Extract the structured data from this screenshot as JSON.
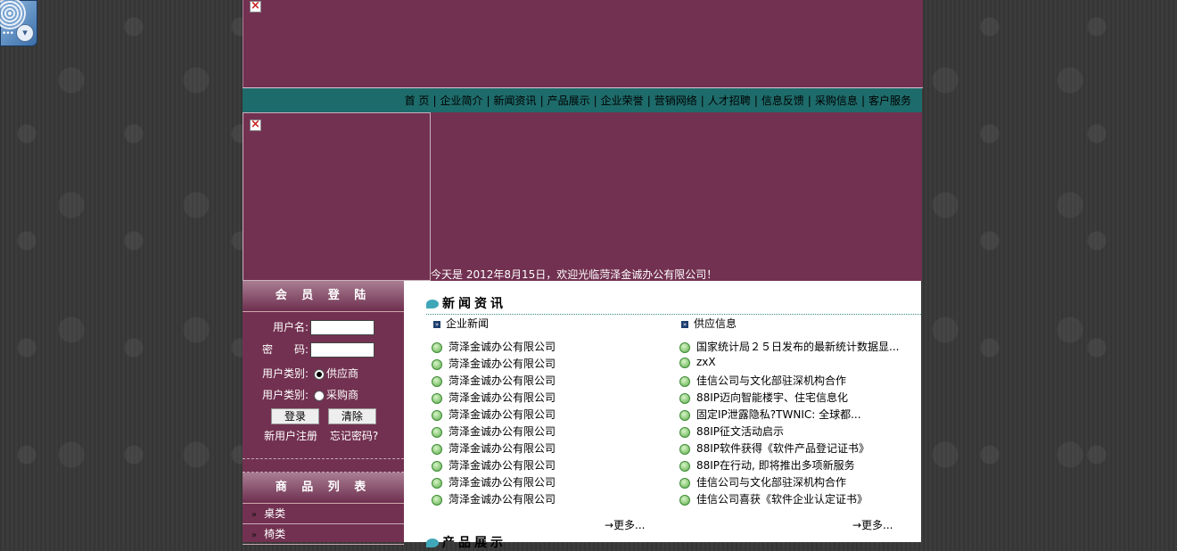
{
  "nav": {
    "items": [
      "首 页",
      "企业简介",
      "新闻资讯",
      "产品展示",
      "企业荣誉",
      "营销网络",
      "人才招聘",
      "信息反馈",
      "采购信息",
      "客户服务"
    ]
  },
  "close_glyph": "×",
  "welcome": "今天是 2012年8月15日，欢迎光临菏泽金诚办公有限公司！",
  "login": {
    "title": "会 员 登 陆",
    "username_label": "用户名:",
    "password_label": "密　　码:",
    "type_label_1": "用户类别:",
    "type_option_1": "供应商",
    "type_label_2": "用户类别:",
    "type_option_2": "采购商",
    "login_button": "登录",
    "clear_button": "清除",
    "register_link": "新用户注册",
    "forgot_link": "忘记密码?"
  },
  "products": {
    "title": "商 品 列 表",
    "items": [
      "桌类",
      "椅类"
    ]
  },
  "news": {
    "title": "新闻资讯",
    "left": {
      "heading": "企业新闻",
      "items": [
        "菏泽金诚办公有限公司",
        "菏泽金诚办公有限公司",
        "菏泽金诚办公有限公司",
        "菏泽金诚办公有限公司",
        "菏泽金诚办公有限公司",
        "菏泽金诚办公有限公司",
        "菏泽金诚办公有限公司",
        "菏泽金诚办公有限公司",
        "菏泽金诚办公有限公司",
        "菏泽金诚办公有限公司"
      ],
      "more": "→更多..."
    },
    "right": {
      "heading": "供应信息",
      "items": [
        "国家统计局２５日发布的最新统计数据显...",
        "zxX",
        "佳信公司与文化部驻深机构合作",
        "88IP迈向智能楼宇、住宅信息化",
        "固定IP泄露隐私?TWNIC: 全球都...",
        "88IP征文活动启示",
        "88IP软件获得《软件产品登记证书》",
        "88IP在行动, 即将推出多项新服务",
        "佳信公司与文化部驻深机构合作",
        "佳信公司喜获《软件企业认定证书》"
      ],
      "more": "→更多..."
    }
  },
  "products_section": {
    "title": "产品展示"
  }
}
